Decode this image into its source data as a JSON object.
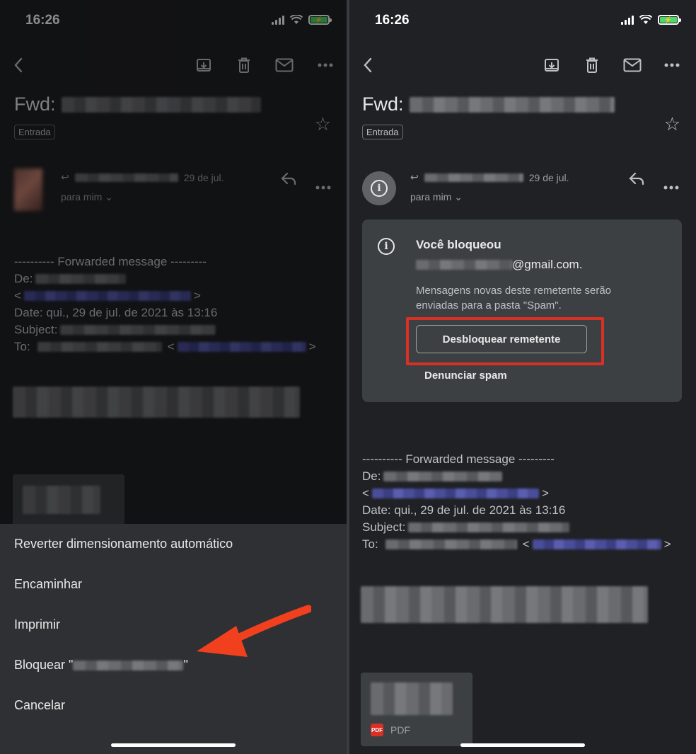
{
  "status": {
    "time": "16:26"
  },
  "email": {
    "subject_prefix": "Fwd:",
    "label": "Entrada",
    "date": "29 de jul.",
    "to_me": "para mim ⌄",
    "forwarded_header": "---------- Forwarded message ---------",
    "de_label": "De:",
    "date_line": "Date: qui., 29 de jul. de 2021 às 13:16",
    "subject_label": "Subject:",
    "to_label": "To:",
    "lt": "<",
    "gt": ">",
    "attachment_type": "PDF"
  },
  "menu": {
    "items": [
      "Reverter dimensionamento automático",
      "Encaminhar",
      "Imprimir",
      "Bloquear \"",
      "Cancelar"
    ],
    "block_suffix": "\""
  },
  "blocked_notice": {
    "title": "Você bloqueou",
    "email_suffix": "@gmail.com.",
    "message": "Mensagens novas deste remetente serão enviadas para a pasta \"Spam\".",
    "unblock_button": "Desbloquear remetente",
    "report_spam": "Denunciar spam"
  },
  "colors": {
    "background": "#202124",
    "card": "#3c4043",
    "highlight": "#d93025",
    "arrow": "#f0401e"
  },
  "icons": [
    "back-icon",
    "archive-icon",
    "trash-icon",
    "mail-icon",
    "more-icon",
    "star-icon",
    "reply-icon",
    "info-icon",
    "pdf-icon"
  ]
}
